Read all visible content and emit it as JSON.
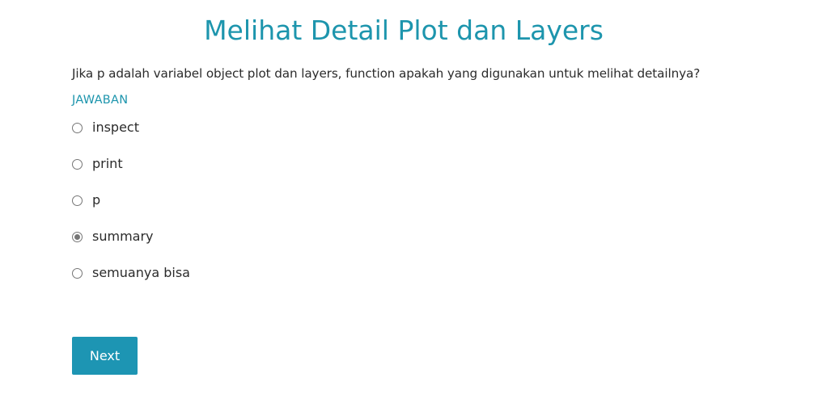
{
  "page": {
    "title": "Melihat Detail Plot dan Layers"
  },
  "quiz": {
    "question": "Jika p adalah variabel object plot dan layers, function apakah yang digunakan untuk melihat detailnya?",
    "answer_label": "JAWABAN",
    "options": [
      {
        "label": "inspect",
        "selected": false
      },
      {
        "label": "print",
        "selected": false
      },
      {
        "label": "p",
        "selected": false
      },
      {
        "label": "summary",
        "selected": true
      },
      {
        "label": "semuanya bisa",
        "selected": false
      }
    ],
    "next_label": "Next"
  },
  "colors": {
    "accent": "#1d95ad",
    "button": "#1d95b3",
    "text": "#2b2b2b"
  }
}
